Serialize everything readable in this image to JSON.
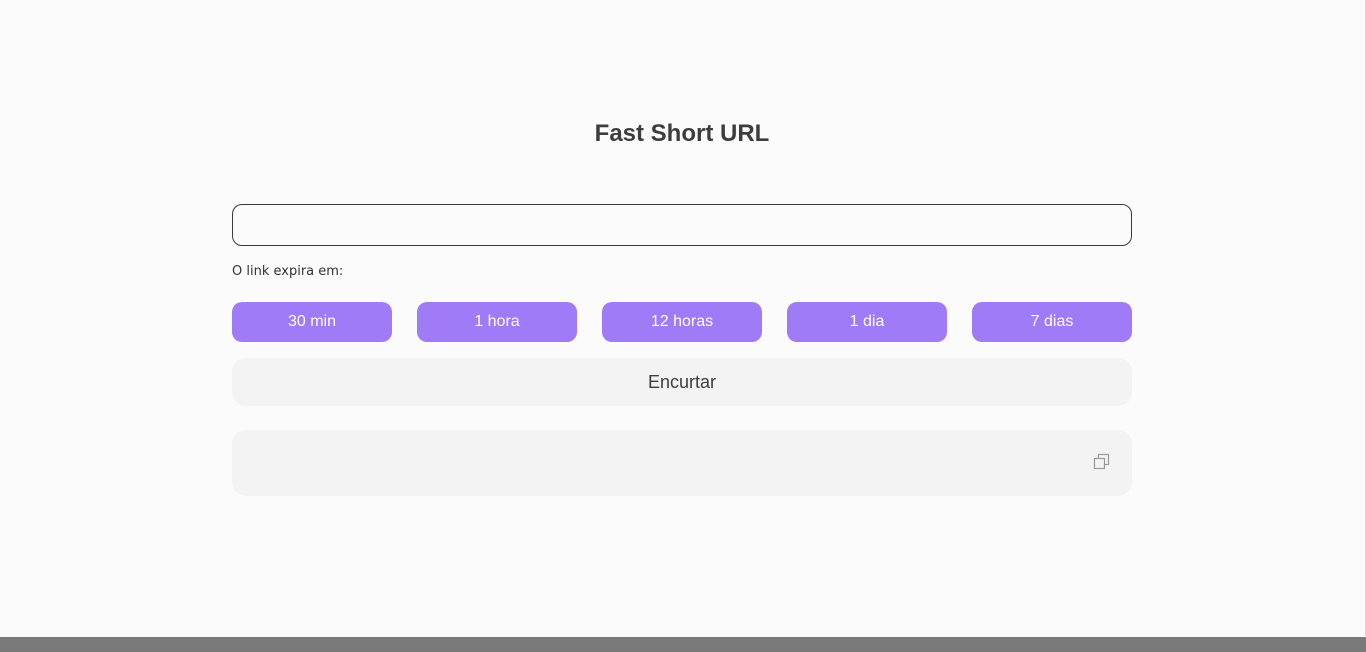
{
  "app": {
    "title": "Fast Short URL"
  },
  "form": {
    "url_input_value": "",
    "expire_label": "O link expira em:",
    "options": [
      {
        "label": "30 min"
      },
      {
        "label": "1 hora"
      },
      {
        "label": "12 horas"
      },
      {
        "label": "1 dia"
      },
      {
        "label": "7 dias"
      }
    ],
    "shorten_label": "Encurtar"
  },
  "result": {
    "short_url": "",
    "copy_icon": "copy-icon"
  },
  "colors": {
    "accent": "#a07bf7",
    "title": "#3d3d3d",
    "panel": "#f3f3f3",
    "background": "#fbfbfb"
  }
}
